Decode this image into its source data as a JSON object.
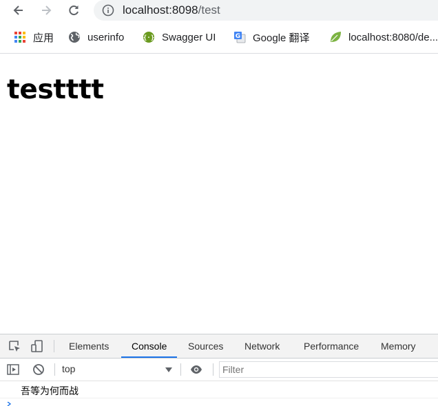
{
  "browser": {
    "url_host": "localhost:8098",
    "url_path": "/test",
    "nav": {
      "back_icon": "arrow-left-icon",
      "forward_icon": "arrow-right-icon",
      "reload_icon": "reload-icon"
    },
    "info_icon": "info-icon"
  },
  "bookmarks": [
    {
      "label": "应用",
      "icon": "apps-grid-icon"
    },
    {
      "label": "userinfo",
      "icon": "globe-icon"
    },
    {
      "label": "Swagger UI",
      "icon": "swagger-icon"
    },
    {
      "label": "Google 翻译",
      "icon": "google-translate-icon"
    },
    {
      "label": "localhost:8080/de...",
      "icon": "leaf-icon"
    }
  ],
  "page": {
    "heading": "testttt"
  },
  "devtools": {
    "tabs": [
      "Elements",
      "Console",
      "Sources",
      "Network",
      "Performance",
      "Memory"
    ],
    "active_tab": "Console",
    "context": "top",
    "filter_placeholder": "Filter",
    "console_messages": [
      "吾等为何而战"
    ],
    "accent_color": "#1a73e8"
  }
}
